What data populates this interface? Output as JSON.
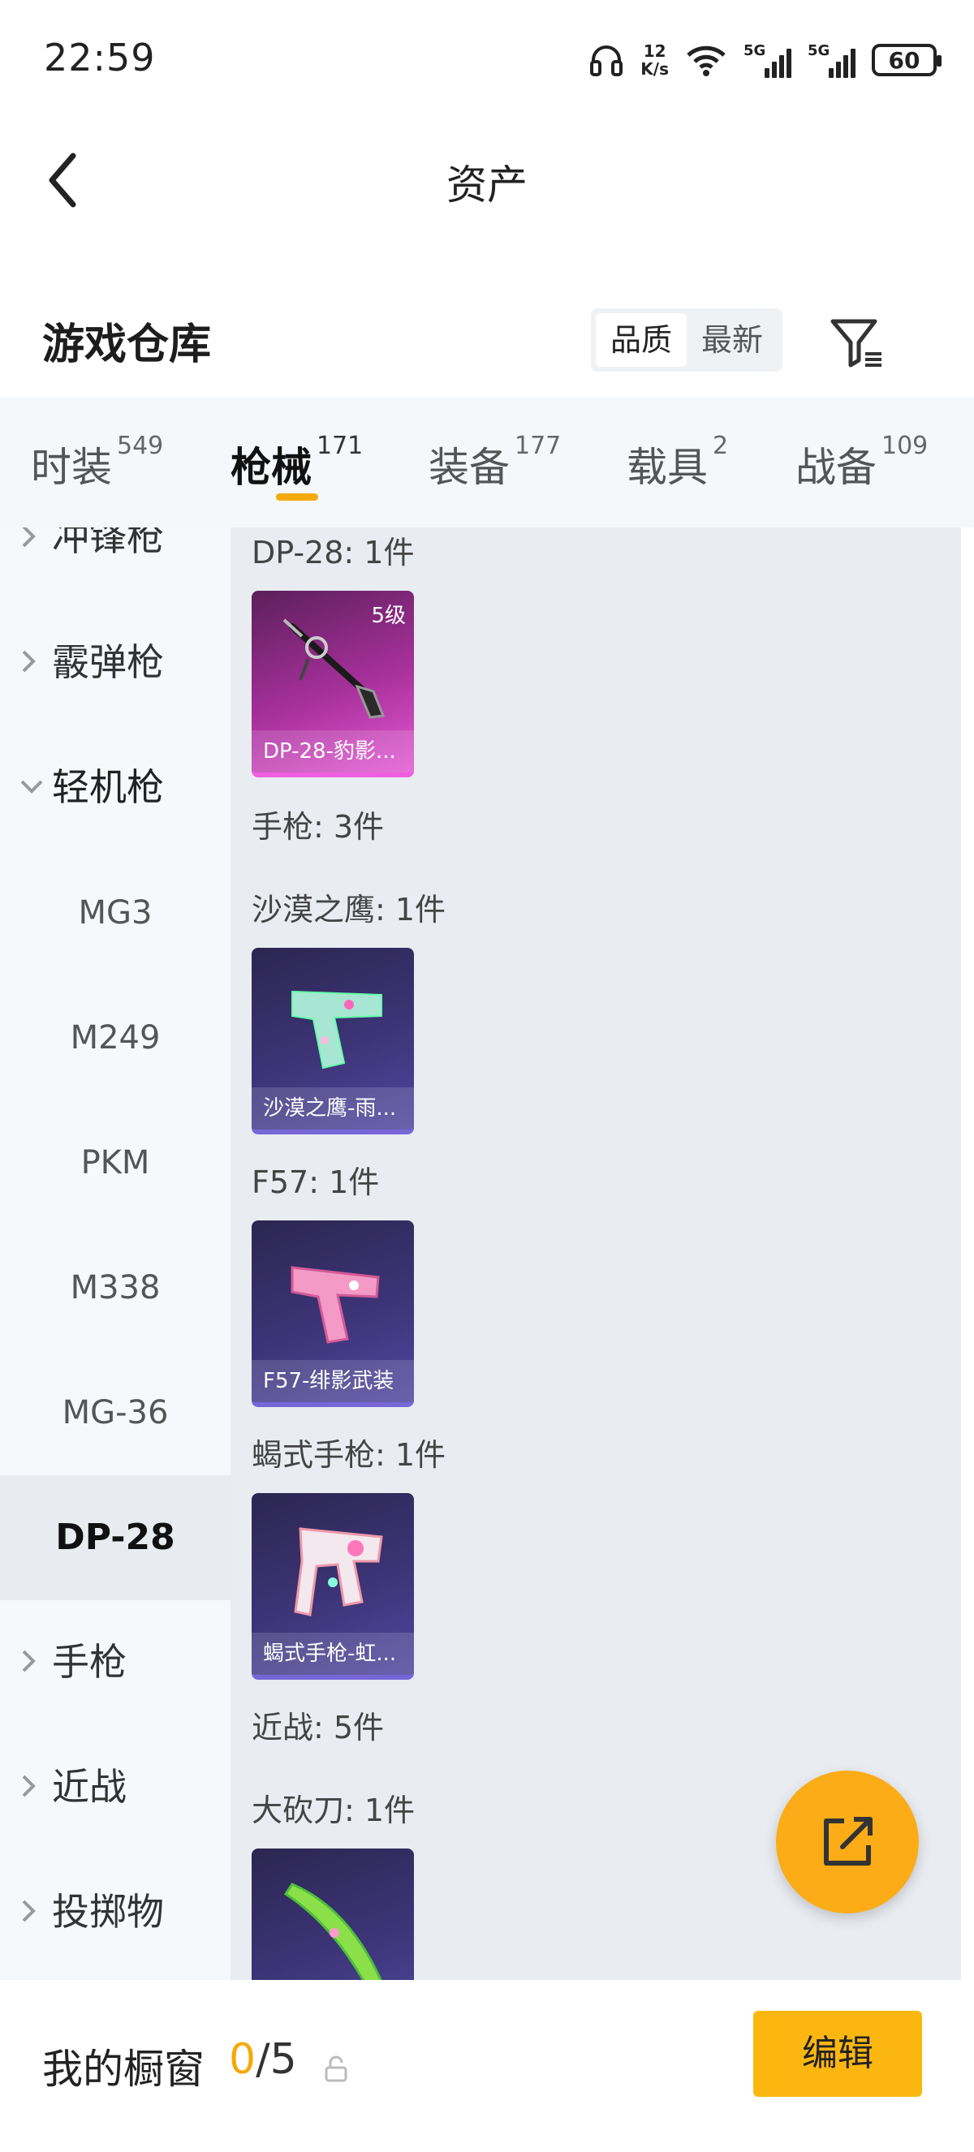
{
  "status_bar": {
    "time": "22:59",
    "speed_value": "12",
    "speed_unit": "K/s",
    "signal_1": "5G",
    "signal_2": "5G",
    "battery": "60"
  },
  "header": {
    "title": "资产"
  },
  "section": {
    "title": "游戏仓库",
    "sort_options": [
      "品质",
      "最新"
    ],
    "sort_selected": "品质"
  },
  "tabs": [
    {
      "label": "时装",
      "count": "549"
    },
    {
      "label": "枪械",
      "count": "171"
    },
    {
      "label": "装备",
      "count": "177"
    },
    {
      "label": "载具",
      "count": "2"
    },
    {
      "label": "战备",
      "count": "109"
    }
  ],
  "active_tab": "枪械",
  "sidebar": {
    "categories": {
      "smg": "冲锋枪",
      "shotgun": "霰弹枪",
      "lmg": "轻机枪",
      "pistol": "手枪",
      "melee": "近战",
      "throwable": "投掷物"
    },
    "lmg_items": [
      "MG3",
      "M249",
      "PKM",
      "M338",
      "MG-36",
      "DP-28"
    ],
    "selected": "DP-28"
  },
  "content": {
    "groups": {
      "dp28": "DP-28: 1件",
      "pistol": "手枪: 3件",
      "deagle": "沙漠之鹰: 1件",
      "f57": "F57: 1件",
      "scorpion": "蝎式手枪: 1件",
      "melee": "近战: 5件",
      "machete": "大砍刀: 1件"
    },
    "cards": {
      "dp28": {
        "name": "DP-28-豹影...",
        "level": "5级"
      },
      "deagle": {
        "name": "沙漠之鹰-雨..."
      },
      "f57": {
        "name": "F57-绯影武装"
      },
      "scorpion": {
        "name": "蝎式手枪-虹..."
      }
    }
  },
  "bottom_bar": {
    "label": "我的橱窗",
    "current": "0",
    "total": "/5",
    "edit_label": "编辑"
  },
  "colors": {
    "accent": "#f5a90a",
    "fab": "#fbac16",
    "edit_button": "#fbb710",
    "legendary_card": "#a7309b",
    "epic_card": "#3d3477"
  },
  "icons": [
    "back-arrow-icon",
    "filter-icon",
    "chevron-right-icon",
    "chevron-down-icon",
    "share-icon",
    "lock-icon",
    "headset-icon",
    "wifi-icon",
    "battery-icon"
  ]
}
